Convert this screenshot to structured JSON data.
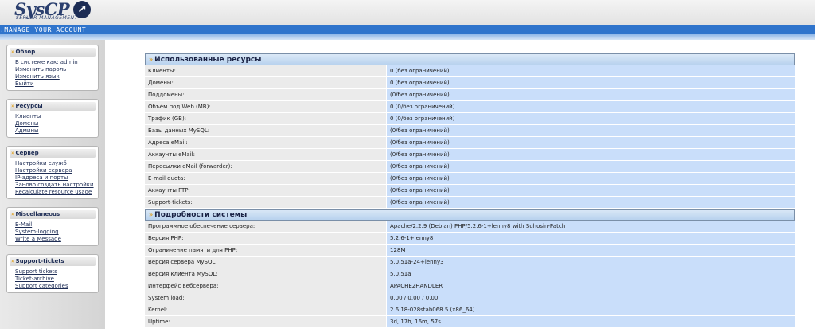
{
  "header": {
    "logo_text": "SysCP",
    "logo_subtitle": "SERVER MANAGEMENT",
    "title": ":MANAGE YOUR ACCOUNT"
  },
  "sidebar": {
    "sections": [
      {
        "title": "Обзор",
        "items": [
          {
            "label": "В системе как: admin"
          },
          {
            "label": "Изменить пароль"
          },
          {
            "label": "Изменить язык"
          },
          {
            "label": "Выйти"
          }
        ]
      },
      {
        "title": "Ресурсы",
        "items": [
          {
            "label": "Клиенты"
          },
          {
            "label": "Домены"
          },
          {
            "label": "Админы"
          }
        ]
      },
      {
        "title": "Сервер",
        "items": [
          {
            "label": "Настройки служб"
          },
          {
            "label": "Настройки сервера"
          },
          {
            "label": "IP-адреса и порты"
          },
          {
            "label": "Заново создать настройки"
          },
          {
            "label": "Recalculate resource usage"
          }
        ]
      },
      {
        "title": "Miscellaneous",
        "items": [
          {
            "label": "E-Mail"
          },
          {
            "label": "System-logging"
          },
          {
            "label": "Write a Message"
          }
        ]
      },
      {
        "title": "Support-tickets",
        "items": [
          {
            "label": "Support tickets"
          },
          {
            "label": "Ticket-archive"
          },
          {
            "label": "Support categories"
          }
        ]
      }
    ]
  },
  "resources": {
    "title": "Использованные ресурсы",
    "rows": [
      {
        "label": "Клиенты:",
        "value": "0 (без ограничений)"
      },
      {
        "label": "Домены:",
        "value": "0 (без ограничений)"
      },
      {
        "label": "Поддомены:",
        "value": "(0/без ограничений)"
      },
      {
        "label": "Объём под Web (MB):",
        "value": "0 (0/без ограничений)"
      },
      {
        "label": "Трафик (GB):",
        "value": "0 (0/без ограничений)"
      },
      {
        "label": "Базы данных MySQL:",
        "value": "(0/без ограничений)"
      },
      {
        "label": "Адреса eMail:",
        "value": "(0/без ограничений)"
      },
      {
        "label": "Аккаунты eMail:",
        "value": "(0/без ограничений)"
      },
      {
        "label": "Пересылки eMail (forwarder):",
        "value": "(0/без ограничений)"
      },
      {
        "label": "E-mail quota:",
        "value": "(0/без ограничений)"
      },
      {
        "label": "Аккаунты FTP:",
        "value": "(0/без ограничений)"
      },
      {
        "label": "Support-tickets:",
        "value": "(0/без ограничений)"
      }
    ]
  },
  "system": {
    "title": "Подробности системы",
    "rows": [
      {
        "label": "Программное обеспечение сервера:",
        "value": "Apache/2.2.9 (Debian) PHP/5.2.6-1+lenny8 with Suhosin-Patch"
      },
      {
        "label": "Версия PHP:",
        "value": "5.2.6-1+lenny8"
      },
      {
        "label": "Ограничение памяти для PHP:",
        "value": "128M"
      },
      {
        "label": "Версия сервера MySQL:",
        "value": "5.0.51a-24+lenny3"
      },
      {
        "label": "Версия клиента MySQL:",
        "value": "5.0.51a"
      },
      {
        "label": "Интерфейс вебсервера:",
        "value": "APACHE2HANDLER"
      },
      {
        "label": "System load:",
        "value": "0.00 / 0.00 / 0.00"
      },
      {
        "label": "Kernel:",
        "value": "2.6.18-028stab068.5 (x86_64)"
      },
      {
        "label": "Uptime:",
        "value": "3d, 17h, 16m, 57s"
      }
    ]
  }
}
